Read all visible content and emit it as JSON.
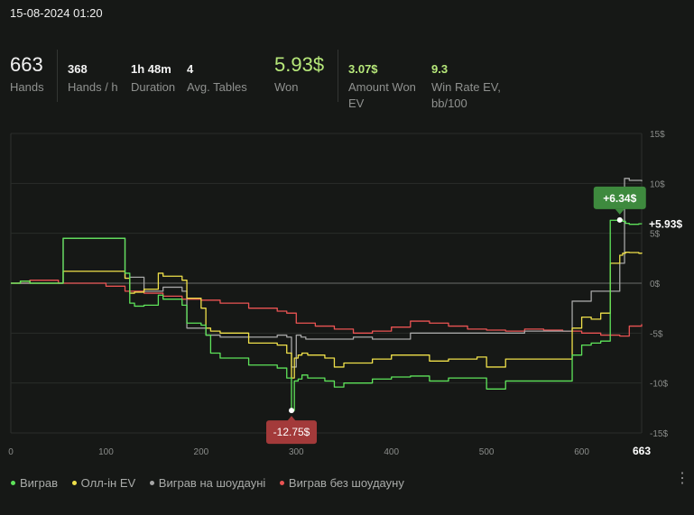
{
  "header": {
    "datetime": "15-08-2024 01:20"
  },
  "stats": [
    {
      "value": "663",
      "label": "Hands"
    },
    {
      "value": "368",
      "label": "Hands / h"
    },
    {
      "value": "1h 48m",
      "label": "Duration"
    },
    {
      "value": "4",
      "label": "Avg. Tables"
    },
    {
      "value": "5.93$",
      "label": "Won"
    },
    {
      "value": "3.07$",
      "label": "Amount Won EV"
    },
    {
      "value": "9.3",
      "label": "Win Rate EV, bb/100"
    }
  ],
  "colors": {
    "won": "#5ee35a",
    "allin_ev": "#efe04a",
    "showdown": "#a6a6a6",
    "nonshowdown": "#ea5353",
    "max_badge": "#3e8a3e",
    "min_badge": "#a33a3a"
  },
  "chart_data": {
    "type": "line",
    "x_ticks": [
      "0",
      "100",
      "200",
      "300",
      "400",
      "500",
      "600"
    ],
    "x_end_label": "663",
    "xlim": [
      0,
      663
    ],
    "ylim": [
      -15,
      15
    ],
    "y_ticks": [
      "15$",
      "10$",
      "5$",
      "0$",
      "-5$",
      "-10$",
      "-15$"
    ],
    "y_tick_values": [
      15,
      10,
      5,
      0,
      -5,
      -10,
      -15
    ],
    "grid": true,
    "series": [
      {
        "name": "Виграв",
        "color_key": "won",
        "x": [
          0,
          10,
          20,
          50,
          55,
          60,
          115,
          120,
          125,
          130,
          140,
          155,
          160,
          180,
          185,
          195,
          200,
          205,
          210,
          220,
          250,
          280,
          290,
          295,
          298,
          302,
          306,
          312,
          330,
          340,
          350,
          370,
          380,
          400,
          420,
          440,
          460,
          490,
          500,
          520,
          560,
          590,
          600,
          610,
          620,
          630,
          640,
          643,
          646,
          650,
          660,
          663
        ],
        "y": [
          0,
          0.2,
          0,
          0,
          4.5,
          4.5,
          4.5,
          1,
          -2,
          -2.3,
          -2.2,
          -1.2,
          -1.6,
          -2.2,
          -4,
          -4,
          -4.2,
          -5.2,
          -7,
          -7.5,
          -8.2,
          -8.5,
          -9.5,
          -12.75,
          -9.8,
          -9.6,
          -9.2,
          -9.5,
          -9.8,
          -10.4,
          -10,
          -10,
          -9.6,
          -9.4,
          -9.3,
          -9.8,
          -9.5,
          -9.5,
          -10.6,
          -9.8,
          -9.8,
          -7.2,
          -6.2,
          -6,
          -5.8,
          6.3,
          6.34,
          6.2,
          6.0,
          5.9,
          5.95,
          5.93
        ]
      },
      {
        "name": "Олл-ін EV",
        "color_key": "allin_ev",
        "x": [
          0,
          10,
          20,
          50,
          55,
          60,
          115,
          120,
          125,
          130,
          140,
          155,
          160,
          180,
          185,
          195,
          200,
          205,
          210,
          220,
          250,
          280,
          290,
          295,
          298,
          302,
          306,
          312,
          330,
          340,
          350,
          370,
          380,
          400,
          420,
          440,
          460,
          490,
          500,
          520,
          560,
          590,
          600,
          610,
          620,
          630,
          640,
          643,
          646,
          650,
          660,
          663
        ],
        "y": [
          0,
          0.2,
          0,
          0,
          1.2,
          1.2,
          1.2,
          0.5,
          -1,
          -0.9,
          -0.6,
          1,
          0.7,
          0.3,
          -1.5,
          -1.5,
          -2.5,
          -4.5,
          -4.8,
          -5,
          -6,
          -6.2,
          -7,
          -9.5,
          -7.5,
          -7.2,
          -7,
          -7.2,
          -7.5,
          -8.4,
          -8,
          -8,
          -7.6,
          -7.2,
          -7.2,
          -7.8,
          -7.6,
          -7.4,
          -8.4,
          -7.6,
          -7.6,
          -4.5,
          -3.4,
          -3.6,
          -3,
          2,
          2.8,
          3.0,
          3.1,
          3.07,
          3.0,
          3.07
        ]
      },
      {
        "name": "Виграв на шоудауні",
        "color_key": "showdown",
        "x": [
          0,
          10,
          20,
          50,
          55,
          60,
          115,
          120,
          125,
          140,
          160,
          180,
          185,
          190,
          195,
          200,
          205,
          210,
          220,
          240,
          280,
          290,
          295,
          300,
          305,
          310,
          330,
          360,
          380,
          420,
          460,
          500,
          540,
          560,
          580,
          590,
          600,
          610,
          640,
          645,
          650,
          663
        ],
        "y": [
          0,
          0,
          0,
          0,
          4.5,
          4.5,
          4.5,
          0.5,
          0.6,
          -0.8,
          -0.4,
          -0.8,
          -4.5,
          -4.5,
          -4.5,
          -4.5,
          -5.2,
          -5.2,
          -5.4,
          -5.4,
          -5.2,
          -5.4,
          -8.4,
          -5.2,
          -5.4,
          -5.6,
          -5.6,
          -5.4,
          -5.6,
          -5,
          -5,
          -5,
          -4.8,
          -4.8,
          -4.8,
          -1.8,
          -1.8,
          -0.8,
          2,
          10.5,
          10.3,
          10.2
        ]
      },
      {
        "name": "Виграв без шоудауну",
        "color_key": "nonshowdown",
        "x": [
          0,
          10,
          20,
          50,
          60,
          100,
          120,
          140,
          160,
          180,
          190,
          200,
          220,
          250,
          280,
          290,
          300,
          320,
          340,
          360,
          380,
          400,
          420,
          440,
          460,
          480,
          500,
          520,
          540,
          560,
          580,
          600,
          620,
          640,
          650,
          663
        ],
        "y": [
          0,
          0,
          0.3,
          0,
          0,
          -0.3,
          -0.8,
          -1,
          -1.3,
          -1.6,
          -1.6,
          -1.7,
          -2,
          -2.5,
          -2.8,
          -3,
          -4,
          -4.3,
          -4.6,
          -5,
          -4.8,
          -4.4,
          -3.8,
          -4,
          -4.3,
          -4.6,
          -4.7,
          -4.8,
          -4.6,
          -4.7,
          -4.8,
          -5,
          -5.2,
          -5.3,
          -4.3,
          -4.1
        ]
      }
    ],
    "annotations": {
      "max": {
        "label": "+6.34$",
        "x": 640,
        "y": 6.34
      },
      "min": {
        "label": "-12.75$",
        "x": 295,
        "y": -12.75
      },
      "final": {
        "label": "+5.93$",
        "x": 663,
        "y": 5.93
      }
    },
    "legend": {
      "position": "bottom-left",
      "items": [
        "Виграв",
        "Олл-ін EV",
        "Виграв на шоудауні",
        "Виграв без шоудауну"
      ]
    }
  },
  "menu": {
    "icon": "more-vertical-icon"
  }
}
